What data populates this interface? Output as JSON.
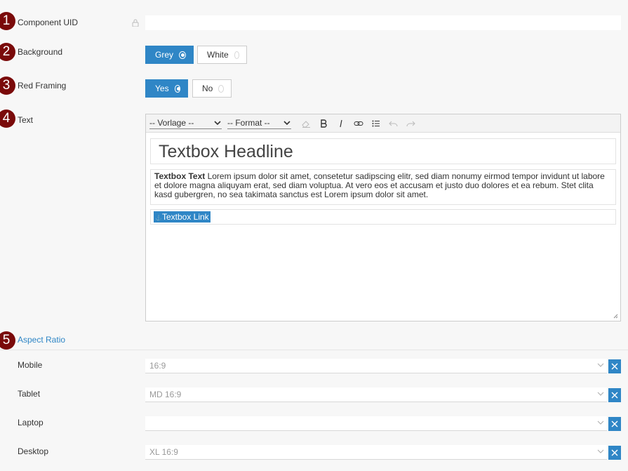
{
  "badges": [
    "1",
    "2",
    "3",
    "4",
    "5"
  ],
  "fields": {
    "component_uid": {
      "label": "Component UID",
      "value": ""
    },
    "background": {
      "label": "Background",
      "options": [
        "Grey",
        "White"
      ],
      "selected": "Grey"
    },
    "red_framing": {
      "label": "Red Framing",
      "options": [
        "Yes",
        "No"
      ],
      "selected": "Yes"
    },
    "text": {
      "label": "Text"
    }
  },
  "editor": {
    "toolbar": {
      "vorlage": "-- Vorlage --",
      "format": "-- Format --",
      "icons": [
        "eraser-icon",
        "bold-icon",
        "italic-icon",
        "link-icon",
        "list-icon",
        "undo-icon",
        "redo-icon"
      ]
    },
    "headline": "Textbox Headline",
    "paragraph_bold": "Textbox Text",
    "paragraph_text": " Lorem ipsum dolor sit amet, consetetur sadipscing elitr, sed diam nonumy eirmod tempor invidunt ut labore et dolore magna aliquyam erat, sed diam voluptua. At vero eos et accusam et justo duo dolores et ea rebum. Stet clita kasd gubergren, no sea takimata sanctus est Lorem ipsum dolor sit amet.",
    "link_text": "Textbox Link"
  },
  "aspect_ratio": {
    "title": "Aspect Ratio",
    "rows": [
      {
        "label": "Mobile",
        "value": "16:9"
      },
      {
        "label": "Tablet",
        "value": "MD 16:9"
      },
      {
        "label": "Laptop",
        "value": ""
      },
      {
        "label": "Desktop",
        "value": "XL 16:9"
      }
    ]
  },
  "colors": {
    "accent": "#2f86c6",
    "badge": "#7a0a0a"
  }
}
